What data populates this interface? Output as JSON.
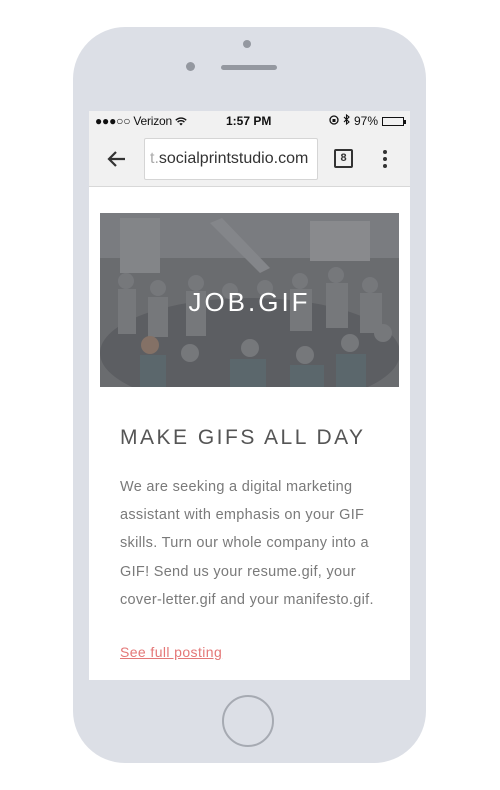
{
  "status_bar": {
    "carrier": "●●●○○ Verizon",
    "time": "1:57 PM",
    "battery": "97%",
    "battery_level": 0.97
  },
  "browser": {
    "url_faded": "t.",
    "url": "socialprintstudio.com",
    "tab_count": "8"
  },
  "hero": {
    "title": "JOB.GIF"
  },
  "article": {
    "headline": "MAKE GIFS ALL DAY",
    "body": "We are seeking a digital marketing assistant with emphasis on your GIF skills. Turn our whole company into a GIF! Send us your resume.gif, your cover-letter.gif and your manifesto.gif.",
    "link": "See full posting"
  },
  "colors": {
    "link": "#e47777",
    "device": "#dcdfe6",
    "heading": "#555555"
  },
  "icons": {
    "back": "arrow-left-icon",
    "tabs": "tab-switcher-icon",
    "menu": "more-vertical-icon"
  }
}
